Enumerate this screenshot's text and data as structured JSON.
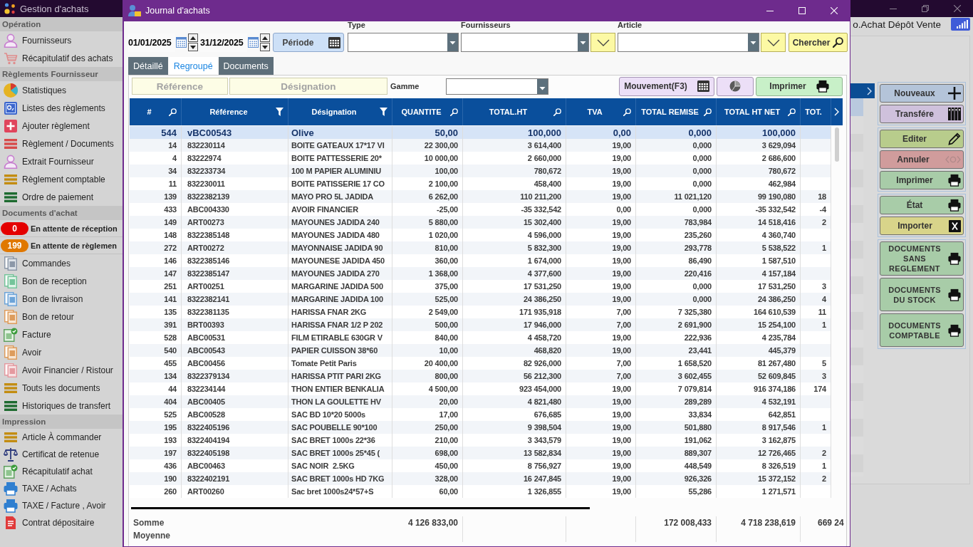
{
  "app": {
    "title": "Gestion d'achats",
    "context": "o.Achat Dépôt Vente"
  },
  "sidebar": {
    "sections": [
      {
        "title": "Opération",
        "items": [
          {
            "kind": "link",
            "label": "Fournisseurs"
          },
          {
            "kind": "link",
            "label": "Récapitulatif des achats"
          }
        ]
      },
      {
        "title": "Règlements Fournisseur",
        "items": [
          {
            "kind": "link",
            "label": "Statistiques"
          },
          {
            "kind": "link",
            "label": "Listes des règlements"
          },
          {
            "kind": "link",
            "label": "Ajouter règlement"
          },
          {
            "kind": "link",
            "label": "Règlement / Documents"
          },
          {
            "kind": "link",
            "label": "Extrait Fournisseur"
          },
          {
            "kind": "link",
            "label": "Règlement comptable"
          },
          {
            "kind": "link",
            "label": "Ordre de paiement"
          }
        ]
      },
      {
        "title": "Documents d'achat",
        "items": [
          {
            "kind": "counter",
            "count": "0",
            "label": "En attente de réception",
            "color": "#e40000"
          },
          {
            "kind": "counter",
            "count": "199",
            "label": "En attente de règlemen",
            "color": "#e07800"
          },
          {
            "kind": "link",
            "label": "Commandes"
          },
          {
            "kind": "link",
            "label": "Bon de reception"
          },
          {
            "kind": "link",
            "label": "Bon de livraison"
          },
          {
            "kind": "link",
            "label": "Bon de retour"
          },
          {
            "kind": "link",
            "label": "Facture"
          },
          {
            "kind": "link",
            "label": "Avoir"
          },
          {
            "kind": "link",
            "label": "Avoir Financier / Ristour"
          },
          {
            "kind": "link",
            "label": "Touts les documents"
          },
          {
            "kind": "link",
            "label": "Historiques de transfert"
          }
        ]
      },
      {
        "title": "Impression",
        "items": [
          {
            "kind": "link",
            "label": "Article À commander"
          },
          {
            "kind": "link",
            "label": "Certificat de retenue"
          },
          {
            "kind": "link",
            "label": "Récapitulatif achat"
          },
          {
            "kind": "link",
            "label": "TAXE / Achats"
          },
          {
            "kind": "link",
            "label": "TAXE / Facture , Avoir"
          },
          {
            "kind": "link",
            "label": "Contrat dépositaire"
          }
        ]
      }
    ]
  },
  "main_panel": {
    "action_groups": [
      {
        "buttons": [
          {
            "kind": "add",
            "label": "Nouveaux",
            "color": "#b4c4d9"
          },
          {
            "kind": "transfer",
            "label": "Transfére",
            "color": "#cfc1dc"
          }
        ]
      },
      {
        "buttons": [
          {
            "kind": "edit",
            "label": "Editer",
            "color": "#b8cc8c"
          },
          {
            "kind": "cancel",
            "label": "Annuler",
            "color": "#d09c9c"
          },
          {
            "kind": "print",
            "label": "Imprimer",
            "color": "#a8cca8"
          }
        ]
      },
      {
        "buttons": [
          {
            "kind": "print",
            "label": "État",
            "color": "#a8cca8"
          },
          {
            "kind": "import",
            "label": "Importer",
            "color": "#d8d48a"
          }
        ]
      },
      {
        "buttons": [
          {
            "kind": "report",
            "label": "DOCUMENTS SANS REGLEMENT",
            "color": "#a8cca8"
          },
          {
            "kind": "report",
            "label": "DOCUMENTS DU STOCK",
            "color": "#a8cca8"
          },
          {
            "kind": "report",
            "label": "DOCUMENTS COMPTABLE",
            "color": "#a8cca8"
          }
        ]
      }
    ]
  },
  "dialog": {
    "title": "Journal d'achats",
    "filters": {
      "date_from": "01/01/2025",
      "date_to": "31/12/2025",
      "period_button": "Période",
      "type": {
        "label": "Type"
      },
      "supplier": {
        "label": "Fournisseurs"
      },
      "article": {
        "label": "Article"
      },
      "search_button": "Chercher"
    },
    "tabs": [
      {
        "label": "Détaillé",
        "selected": false
      },
      {
        "label": "Regroupé",
        "selected": true
      },
      {
        "label": "Documents",
        "selected": false
      }
    ],
    "toolbar": {
      "reference": {
        "placeholder": "Référence"
      },
      "designation": {
        "placeholder": "Désignation"
      },
      "range": {
        "label": "Gamme"
      },
      "buttons": [
        {
          "kind": "movement",
          "label": "Mouvement(F3)"
        },
        {
          "kind": "chart"
        },
        {
          "kind": "print",
          "label": "Imprimer"
        }
      ]
    },
    "table": {
      "columns": [
        {
          "label": "#",
          "kind": "search"
        },
        {
          "label": "Référence",
          "kind": "filter"
        },
        {
          "label": "Désignation",
          "kind": "filter"
        },
        {
          "label": "QUANTITE",
          "kind": "search"
        },
        {
          "label": "TOTAL.HT",
          "kind": "search"
        },
        {
          "label": "TVA",
          "kind": "search"
        },
        {
          "label": "TOTAL REMISE",
          "kind": "search"
        },
        {
          "label": "TOTAL HT NET",
          "kind": "search"
        },
        {
          "label": "TOT.",
          "kind": "plain"
        }
      ],
      "rows": [
        {
          "selected": true,
          "cells": [
            "544",
            "vBC00543",
            "Olive",
            "50,00",
            "100,000",
            "0,00",
            "0,000",
            "100,000"
          ]
        },
        {
          "selected": false,
          "cells": [
            "14",
            "832230114",
            "BOITE GATEAUX 17*17 VI",
            "22 300,00",
            "3 614,400",
            "19,00",
            "0,000",
            "3 629,094"
          ]
        },
        {
          "selected": false,
          "cells": [
            "4",
            "83222974",
            "BOITE PATTESSERIE 20*",
            "10 000,00",
            "2 660,000",
            "19,00",
            "0,000",
            "2 686,600"
          ]
        },
        {
          "selected": false,
          "cells": [
            "34",
            "832233734",
            "100 M PAPIER ALUMINIU",
            "100,00",
            "780,672",
            "19,00",
            "0,000",
            "780,672"
          ]
        },
        {
          "selected": false,
          "cells": [
            "11",
            "832230011",
            "BOITE PATISSERIE 17 CO",
            "2 100,00",
            "458,400",
            "19,00",
            "0,000",
            "462,984"
          ]
        },
        {
          "selected": false,
          "cells": [
            "139",
            "8322382139",
            "MAYO PRO 5L JADIDA",
            "6 262,00",
            "110 211,200",
            "19,00",
            "11 021,120",
            "99 190,080",
            "18"
          ]
        },
        {
          "selected": false,
          "cells": [
            "433",
            "ABC004330",
            "AVOIR FINANCIER",
            "-25,00",
            "-35 332,542",
            "0,00",
            "0,000",
            "-35 332,542",
            "-4"
          ]
        },
        {
          "selected": false,
          "cells": [
            "149",
            "ART00273",
            "MAYOUNES JADIDA 240",
            "5 880,00",
            "15 302,400",
            "19,00",
            "783,984",
            "14 518,416",
            "2"
          ]
        },
        {
          "selected": false,
          "cells": [
            "148",
            "8322385148",
            "MAYOUNES JADIDA 480",
            "1 020,00",
            "4 596,000",
            "19,00",
            "235,260",
            "4 360,740"
          ]
        },
        {
          "selected": false,
          "cells": [
            "272",
            "ART00272",
            "MAYONNAISE JADIDA 90",
            "810,00",
            "5 832,300",
            "19,00",
            "293,778",
            "5 538,522",
            "1"
          ]
        },
        {
          "selected": false,
          "cells": [
            "146",
            "8322385146",
            "MAYOUNESE JADIDA 450",
            "360,00",
            "1 674,000",
            "19,00",
            "86,490",
            "1 587,510"
          ]
        },
        {
          "selected": false,
          "cells": [
            "147",
            "8322385147",
            "MAYOUNES JADIDA 270",
            "1 368,00",
            "4 377,600",
            "19,00",
            "220,416",
            "4 157,184"
          ]
        },
        {
          "selected": false,
          "cells": [
            "251",
            "ART00251",
            "MARGARINE JADIDA 500",
            "375,00",
            "17 531,250",
            "19,00",
            "0,000",
            "17 531,250",
            "3"
          ]
        },
        {
          "selected": false,
          "cells": [
            "141",
            "8322382141",
            "MARGARINE JADIDA 100",
            "525,00",
            "24 386,250",
            "19,00",
            "0,000",
            "24 386,250",
            "4"
          ]
        },
        {
          "selected": false,
          "cells": [
            "135",
            "8322381135",
            "HARISSA FNAR 2KG",
            "2 549,00",
            "171 935,918",
            "7,00",
            "7 325,380",
            "164 610,539",
            "11"
          ]
        },
        {
          "selected": false,
          "cells": [
            "391",
            "BRT00393",
            "HARISSA FNAR 1/2 P 202",
            "500,00",
            "17 946,000",
            "7,00",
            "2 691,900",
            "15 254,100",
            "1"
          ]
        },
        {
          "selected": false,
          "cells": [
            "528",
            "ABC00531",
            "FILM ETIRABLE 630GR V",
            "840,00",
            "4 458,720",
            "19,00",
            "222,936",
            "4 235,784"
          ]
        },
        {
          "selected": false,
          "cells": [
            "540",
            "ABC00543",
            "PAPIER CUISSON 38*60",
            "10,00",
            "468,820",
            "19,00",
            "23,441",
            "445,379"
          ]
        },
        {
          "selected": false,
          "cells": [
            "455",
            "ABC00456",
            "Tomate Petit Paris",
            "20 400,00",
            "82 926,000",
            "7,00",
            "1 658,520",
            "81 267,480",
            "5"
          ]
        },
        {
          "selected": false,
          "cells": [
            "134",
            "8322379134",
            "HARISSA PTIT PARI 2KG",
            "800,00",
            "56 212,300",
            "7,00",
            "3 602,455",
            "52 609,845",
            "3"
          ]
        },
        {
          "selected": false,
          "cells": [
            "44",
            "832234144",
            "THON ENTIER BENKALIA",
            "4 500,00",
            "923 454,000",
            "19,00",
            "7 079,814",
            "916 374,186",
            "174"
          ]
        },
        {
          "selected": false,
          "cells": [
            "404",
            "ABC00405",
            "THON LA GOULETTE HV",
            "20,00",
            "4 821,480",
            "19,00",
            "289,289",
            "4 532,191"
          ]
        },
        {
          "selected": false,
          "cells": [
            "525",
            "ABC00528",
            "SAC BD 10*20 5000s",
            "17,00",
            "676,685",
            "19,00",
            "33,834",
            "642,851"
          ]
        },
        {
          "selected": false,
          "cells": [
            "195",
            "8322405196",
            "SAC POUBELLE 90*100",
            "250,00",
            "9 398,504",
            "19,00",
            "501,880",
            "8 917,546",
            "1"
          ]
        },
        {
          "selected": false,
          "cells": [
            "193",
            "8322404194",
            "SAC BRET 1000s 22*36",
            "210,00",
            "3 343,579",
            "19,00",
            "191,062",
            "3 162,875"
          ]
        },
        {
          "selected": false,
          "cells": [
            "197",
            "8322405198",
            "SAC BRET 1000s 25*45 (",
            "698,00",
            "13 582,834",
            "19,00",
            "889,307",
            "12 726,465",
            "2"
          ]
        },
        {
          "selected": false,
          "cells": [
            "436",
            "ABC00463",
            "SAC NOIR  2.5KG",
            "450,00",
            "8 756,927",
            "19,00",
            "448,549",
            "8 326,519",
            "1"
          ]
        },
        {
          "selected": false,
          "cells": [
            "190",
            "8322402191",
            "SAC BRET 1000s HD 7KG",
            "328,00",
            "16 247,845",
            "19,00",
            "926,326",
            "15 372,152",
            "2"
          ]
        },
        {
          "selected": false,
          "cells": [
            "260",
            "ART00260",
            "Sac bret 1000s24*57+S",
            "60,00",
            "1 326,855",
            "19,00",
            "55,286",
            "1 271,571"
          ]
        }
      ],
      "footer": [
        {
          "label": "Somme",
          "values": {
            "3": "4 126 833,00",
            "6": "172 008,433",
            "7": "4 718 238,619",
            "8": "669 24"
          }
        },
        {
          "label": "Moyenne"
        }
      ]
    }
  }
}
